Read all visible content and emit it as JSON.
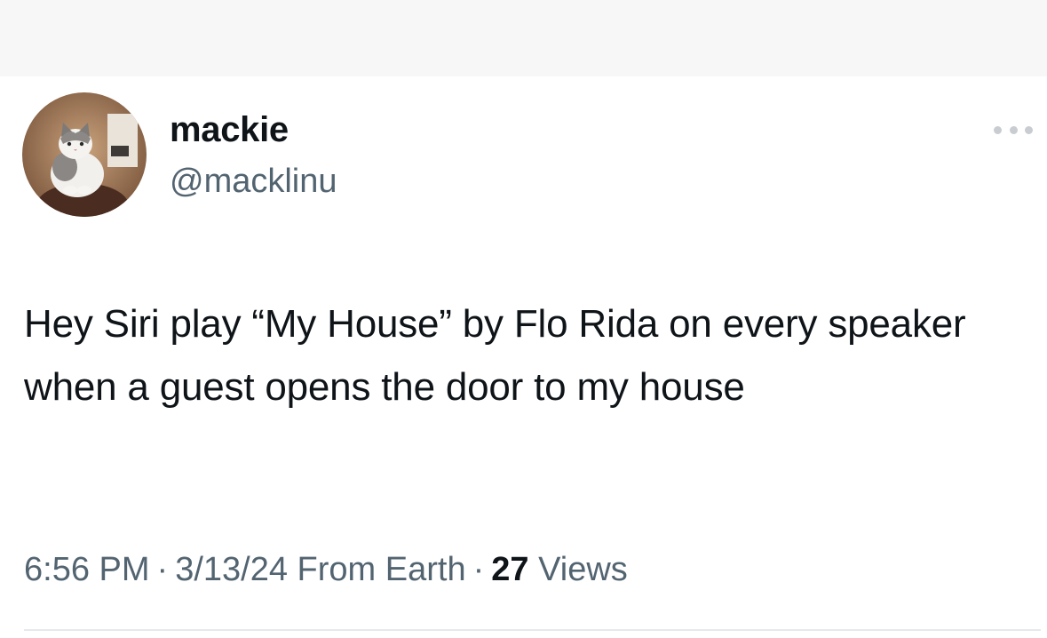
{
  "tweet": {
    "display_name": "mackie",
    "handle": "@macklinu",
    "text": "Hey Siri play “My House” by Flo Rida on every speaker when a guest opens the door to my house",
    "time": "6:56 PM",
    "date": "3/13/24",
    "location": "From Earth",
    "views_count": "27",
    "views_label": "Views",
    "separator": "·"
  },
  "icons": {
    "more": "more-horizontal-icon",
    "avatar": "cat-avatar"
  },
  "colors": {
    "text_primary": "#0f1419",
    "text_secondary": "#536471",
    "background": "#ffffff"
  }
}
